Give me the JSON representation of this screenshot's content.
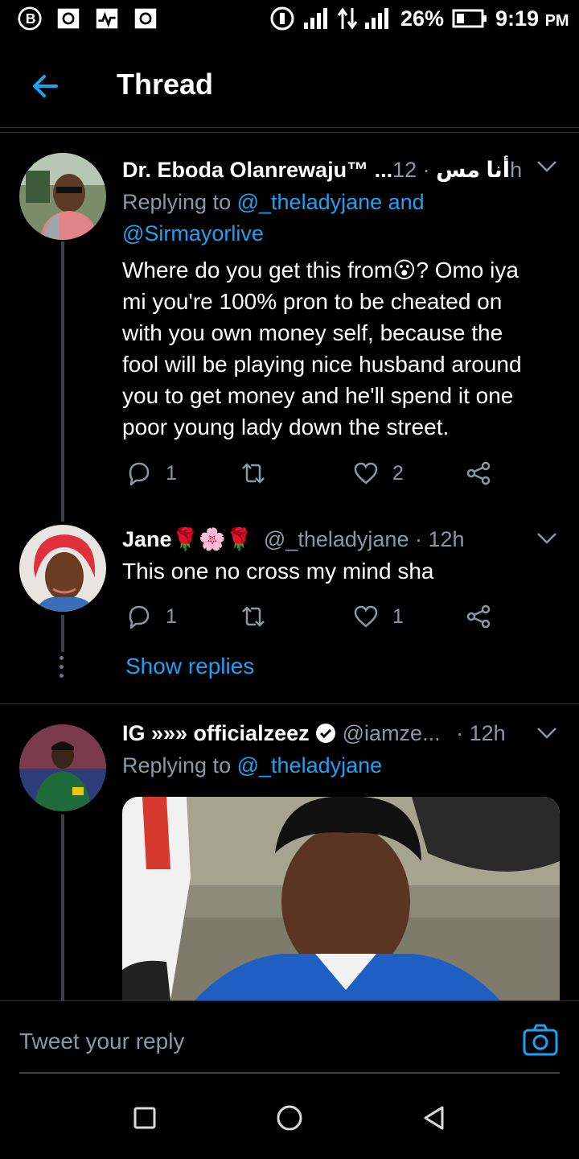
{
  "status_bar": {
    "battery": "26%",
    "time": "9:19",
    "ampm": "PM",
    "icons": [
      "b-app-icon",
      "box-app-icon",
      "activity-app-icon",
      "box-app-icon",
      "hotspot-icon",
      "signal-icon",
      "data-arrows-icon",
      "signal-icon",
      "battery-icon"
    ]
  },
  "header": {
    "title": "Thread",
    "back_icon": "arrow-left-icon"
  },
  "tweets": [
    {
      "name": "Dr. Eboda Olanrewaju™ ...أنا مس",
      "time": "· 12h",
      "replying_prefix": "Replying to",
      "replying_line1": "@_theladyjane and",
      "replying_line2": "@Sirmayorlive",
      "text_lines": [
        "Where do you get this from😮? Omo iya",
        "mi you're 100% pron to be cheated on",
        "with you own money self, because the",
        "fool will be playing nice husband around",
        "you to get money and he'll spend it one",
        "poor young lady down the street."
      ],
      "replies": "1",
      "likes": "2"
    },
    {
      "name": "Jane🌹🌸🌹",
      "handle": "@_theladyjane",
      "time": "· 12h",
      "text": "This one no cross my mind sha",
      "replies": "1",
      "likes": "1",
      "show_replies": "Show replies"
    },
    {
      "name": "IG »»» officialzeez",
      "handle": "@iamze...",
      "time": "· 12h",
      "replying_prefix": "Replying to",
      "replying_line1": "@_theladyjane"
    }
  ],
  "reply_bar": {
    "placeholder": "Tweet your reply"
  },
  "colors": {
    "accent": "#1da1f2",
    "muted": "#8899a6",
    "background": "#000000"
  }
}
